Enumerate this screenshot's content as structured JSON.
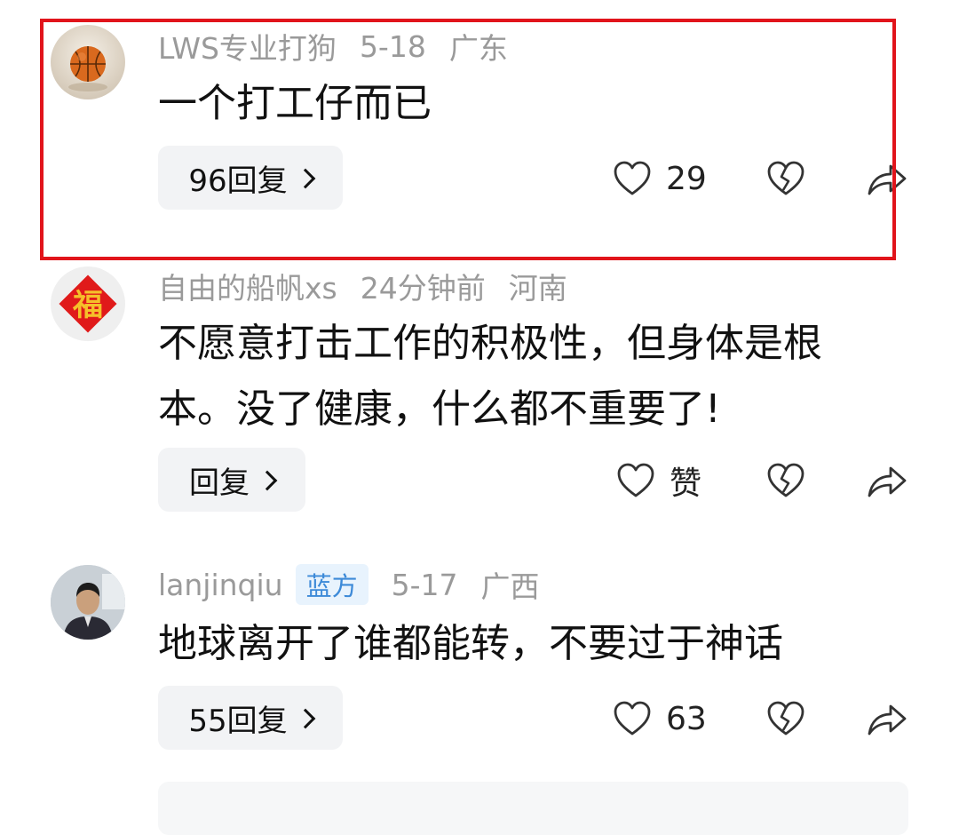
{
  "comments": [
    {
      "username": "LWS专业打狗",
      "date": "5-18",
      "location": "广东",
      "text": "一个打工仔而已",
      "reply_label": "96回复",
      "like_label": "29",
      "avatar": "basketball-avatar"
    },
    {
      "username": "自由的船帆xs",
      "date": "24分钟前",
      "location": "河南",
      "text": "不愿意打击工作的积极性，但身体是根本。没了健康，什么都不重要了!",
      "reply_label": "回复",
      "like_label": "赞",
      "avatar": "fu-character-avatar",
      "avatar_char": "福"
    },
    {
      "username": "lanjinqiu",
      "badge": "蓝方",
      "date": "5-17",
      "location": "广西",
      "text": "地球离开了谁都能转，不要过于神话",
      "reply_label": "55回复",
      "like_label": "63",
      "avatar": "man-photo-avatar"
    }
  ],
  "icons": {
    "like": "heart-icon",
    "dislike": "broken-heart-icon",
    "share": "share-arrow-icon",
    "reply_chevron": "chevron-right-icon"
  },
  "colors": {
    "highlight_border": "#e1141b",
    "meta_text": "#9a9a9a",
    "badge_bg": "#e8f3fd",
    "badge_text": "#3d8ad8",
    "reply_bg": "#f2f3f5"
  }
}
